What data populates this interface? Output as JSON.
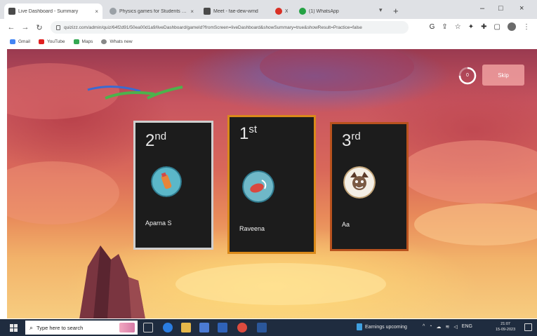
{
  "browser": {
    "tabs": [
      {
        "label": "Live Dashboard - Summary",
        "close": "×",
        "favicon_color": "#4a4a4a",
        "active": true
      },
      {
        "label": "Physics games for Students - Qu",
        "close": "×",
        "favicon_color": "#9aa0a6",
        "active": false
      },
      {
        "label": "Meet - fae-dew-wmd",
        "close": "",
        "favicon_color": "#4a4a4a",
        "active": false
      },
      {
        "label": "X",
        "close": "",
        "favicon_color": "#d93025",
        "active": false
      },
      {
        "label": "(1) WhatsApp",
        "close": "",
        "favicon_color": "#25a244",
        "active": false
      }
    ],
    "new_tab": "+",
    "window_controls": {
      "minimize": "–",
      "maximize": "□",
      "close": "×"
    },
    "url": "quizizz.com/admin/quiz/64f2d91/50ea00d1a9/liveDashboard/gameId?fromScreen=liveDashboard&showSummary=true&showResult=Practice=false",
    "bookmarks": [
      {
        "label": "Gmail",
        "color": "#4285f4"
      },
      {
        "label": "YouTube",
        "color": "#e02020"
      },
      {
        "label": "Maps",
        "color": "#34a853"
      },
      {
        "label": "Whats new",
        "color": "#888888"
      }
    ]
  },
  "game": {
    "timer_value": "0",
    "skip_label": "Skip",
    "podium": [
      {
        "rank": "2",
        "suffix": "nd",
        "name": "Aparna S",
        "frame_color": "#cfcfcf"
      },
      {
        "rank": "1",
        "suffix": "st",
        "name": "Raveena",
        "frame_color": "#d9891a"
      },
      {
        "rank": "3",
        "suffix": "rd",
        "name": "Aa",
        "frame_color": "#b8521e"
      }
    ]
  },
  "taskbar": {
    "search_placeholder": "Type here to search",
    "weather": "Earnings upcoming",
    "language": "ENG",
    "time": "21:07",
    "date": "15-09-2023"
  },
  "colors": {
    "card_background": "#1c1c1c",
    "skip_button": "#f0a0a0",
    "taskbar": "#1f2c3f"
  }
}
